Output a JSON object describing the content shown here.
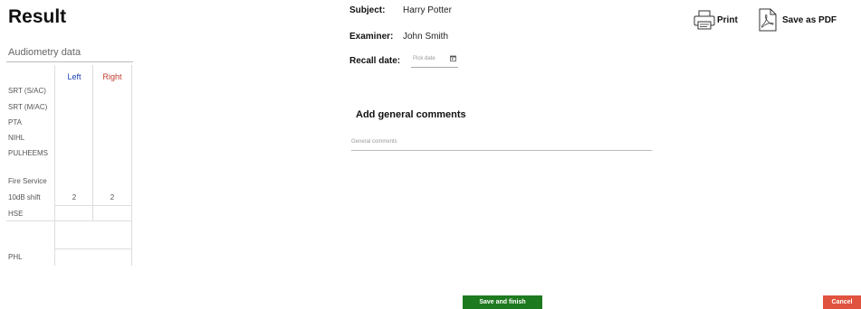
{
  "page": {
    "title": "Result"
  },
  "audiometry": {
    "section_title": "Audiometry data",
    "columns": {
      "left": "Left",
      "right": "Right"
    },
    "rows": {
      "srt_sac": "SRT (S/AC)",
      "srt_mac": "SRT (M/AC)",
      "pta": "PTA",
      "nihl": "NIHL",
      "pulheems": "PULHEEMS",
      "fire_service": "Fire Service",
      "shift_10db": "10dB shift",
      "hse": "HSE",
      "phl": "PHL"
    },
    "values": {
      "shift_left": "2",
      "shift_right": "2"
    }
  },
  "subject": {
    "subject_label": "Subject:",
    "subject_value": "Harry Potter",
    "examiner_label": "Examiner:",
    "examiner_value": "John Smith",
    "recall_label": "Recall date:",
    "recall_placeholder": "Pick date"
  },
  "comments": {
    "title": "Add general comments",
    "placeholder": "General comments"
  },
  "actions": {
    "print": "Print",
    "save_pdf": "Save as PDF"
  },
  "buttons": {
    "save_finish": "Save and finish",
    "cancel": "Cancel"
  },
  "colors": {
    "save": "#1e7a1e",
    "cancel": "#e0533f",
    "left_ear": "#1a3fb0",
    "right_ear": "#c0392b"
  }
}
